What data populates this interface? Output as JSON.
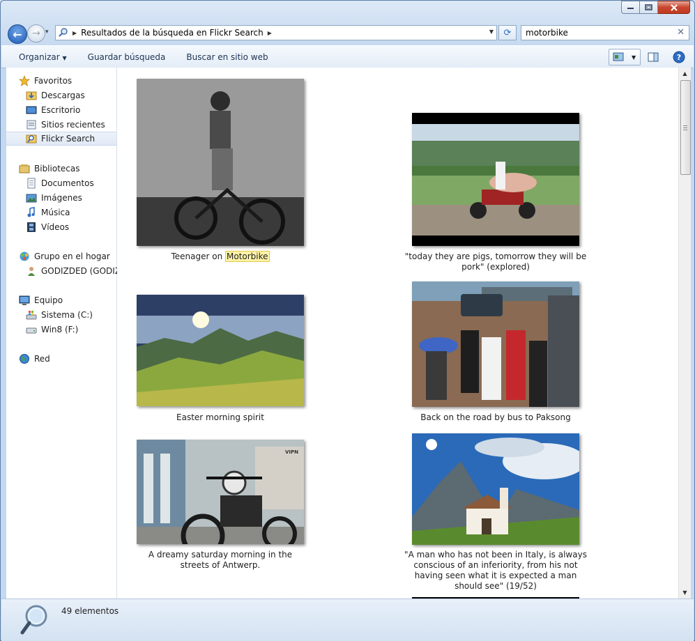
{
  "window": {
    "caption": {
      "minimize": "–",
      "maximize": "□",
      "close": "✕"
    }
  },
  "nav": {
    "back_glyph": "←",
    "forward_glyph": "→",
    "recent_glyph": "▾",
    "address_path": "Resultados de la búsqueda en Flickr Search",
    "address_sep": "▶",
    "address_arrow": "▶",
    "address_dropdown": "▼",
    "refresh_glyph": "⟳",
    "search_value": "motorbike",
    "search_clear": "✕"
  },
  "toolbar": {
    "organize": "Organizar",
    "organize_arrow": "▼",
    "save_search": "Guardar búsqueda",
    "search_web": "Buscar en sitio web",
    "view_arrow": "▼",
    "help_glyph": "?"
  },
  "sidebar": {
    "favorites_header": "Favoritos",
    "favorites": [
      "Descargas",
      "Escritorio",
      "Sitios recientes",
      "Flickr Search"
    ],
    "libraries_header": "Bibliotecas",
    "libraries": [
      "Documentos",
      "Imágenes",
      "Música",
      "Vídeos"
    ],
    "homegroup_header": "Grupo en el hogar",
    "homegroup": [
      "GODIZDED (GODIZDED)"
    ],
    "computer_header": "Equipo",
    "computer": [
      "Sistema (C:)",
      "Win8 (F:)"
    ],
    "network_header": "Red"
  },
  "results": [
    {
      "caption_pre": "Teenager on ",
      "caption_hl": "Motorbike",
      "caption_post": ""
    },
    {
      "caption": "\"today they are pigs, tomorrow they will be pork\" (explored)"
    },
    {
      "caption": "Easter morning spirit"
    },
    {
      "caption": "Back on the road by bus to Paksong"
    },
    {
      "caption": "A dreamy saturday morning in the streets of Antwerp.",
      "watermark": "VIPN"
    },
    {
      "caption": "\"A man who has not been in Italy, is always conscious of an inferiority, from his not having seen what it is expected a man should see\" (19/52)"
    }
  ],
  "scrollbar": {
    "up": "▲",
    "down": "▼"
  },
  "status": {
    "count": "49 elementos"
  },
  "colors": {
    "accent": "#1f5ab7",
    "highlight": "#fff3a8",
    "frame": "#c4d8ef"
  }
}
